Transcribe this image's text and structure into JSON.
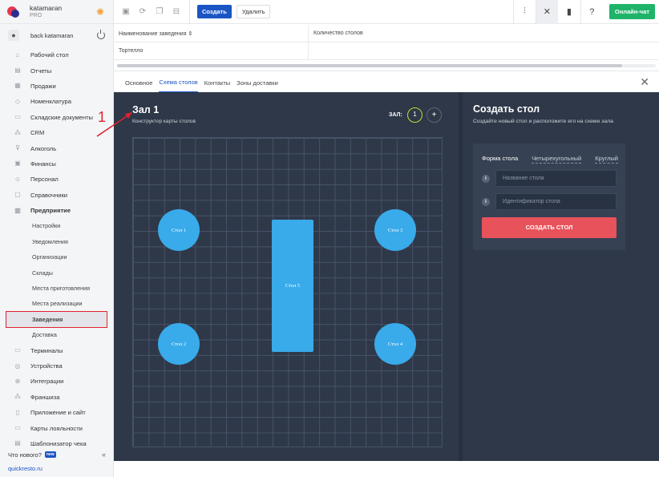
{
  "brand": {
    "name": "katamaran",
    "plan": "PRO"
  },
  "user": {
    "name": "back katamaran"
  },
  "menu": [
    {
      "label": "Рабочий стол",
      "icon": "dashboard-icon"
    },
    {
      "label": "Отчеты",
      "icon": "reports-icon"
    },
    {
      "label": "Продажи",
      "icon": "sales-icon"
    },
    {
      "label": "Номенклатура",
      "icon": "tag-icon"
    },
    {
      "label": "Складские документы",
      "icon": "documents-icon"
    },
    {
      "label": "CRM",
      "icon": "crm-icon"
    },
    {
      "label": "Алкоголь",
      "icon": "glass-icon"
    },
    {
      "label": "Финансы",
      "icon": "finance-icon"
    },
    {
      "label": "Персонал",
      "icon": "staff-icon"
    },
    {
      "label": "Справочники",
      "icon": "book-icon"
    },
    {
      "label": "Предприятие",
      "icon": "building-icon",
      "bold": true
    },
    {
      "label": "Настройки",
      "sub": true
    },
    {
      "label": "Уведомления",
      "sub": true
    },
    {
      "label": "Организации",
      "sub": true
    },
    {
      "label": "Склады",
      "sub": true
    },
    {
      "label": "Места приготовления",
      "sub": true
    },
    {
      "label": "Места реализации",
      "sub": true
    },
    {
      "label": "Заведения",
      "sub": true,
      "active": true
    },
    {
      "label": "Доставка",
      "sub": true
    },
    {
      "label": "Терминалы",
      "icon": "terminal-icon"
    },
    {
      "label": "Устройства",
      "icon": "device-icon"
    },
    {
      "label": "Интеграции",
      "icon": "integration-icon"
    },
    {
      "label": "Франшиза",
      "icon": "franchise-icon"
    },
    {
      "label": "Приложение и сайт",
      "icon": "app-icon"
    },
    {
      "label": "Карты лояльности",
      "icon": "card-icon"
    },
    {
      "label": "Шаблонизатор чека",
      "icon": "receipt-icon"
    }
  ],
  "whatsnew": {
    "label": "Что нового?",
    "badge": "new"
  },
  "site_link": "quickresto.ru",
  "toolbar": {
    "create_label": "Создать",
    "delete_label": "Удалить",
    "chat_label": "Онлайн-чат"
  },
  "table": {
    "headers": [
      "Наименование заведения ⇕",
      "Количество столов"
    ],
    "rows": [
      [
        "Тортелло",
        ""
      ]
    ]
  },
  "tabs": [
    "Основное",
    "Схема столов",
    "Контакты",
    "Зоны доставки"
  ],
  "hall": {
    "title": "Зал 1",
    "subtitle": "Конструктор карты столов",
    "zal_label": "ЗАЛ:",
    "zal_number": "1",
    "add_symbol": "+"
  },
  "tables": [
    {
      "label": "Стол 1",
      "shape": "round"
    },
    {
      "label": "Стол 2",
      "shape": "round"
    },
    {
      "label": "Стол 3",
      "shape": "round"
    },
    {
      "label": "Стол 4",
      "shape": "round"
    },
    {
      "label": "Стол 5",
      "shape": "rect"
    }
  ],
  "panel": {
    "title": "Создать стол",
    "subtitle": "Создайте новый стол и расположите его на схеме зала",
    "form_tabs": [
      "Форма стола",
      "Четырехугольный",
      "Круглый"
    ],
    "name_placeholder": "Название стола",
    "id_placeholder": "Идентификатор стола",
    "submit_label": "СОЗДАТЬ СТОЛ"
  },
  "annotation": {
    "number": "1",
    "color": "#e0222f"
  },
  "colors": {
    "accent": "#1a55c5",
    "table_blue": "#39aaea",
    "workspace": "#2e3848",
    "danger": "#e8525b",
    "chat": "#1fb46a"
  }
}
